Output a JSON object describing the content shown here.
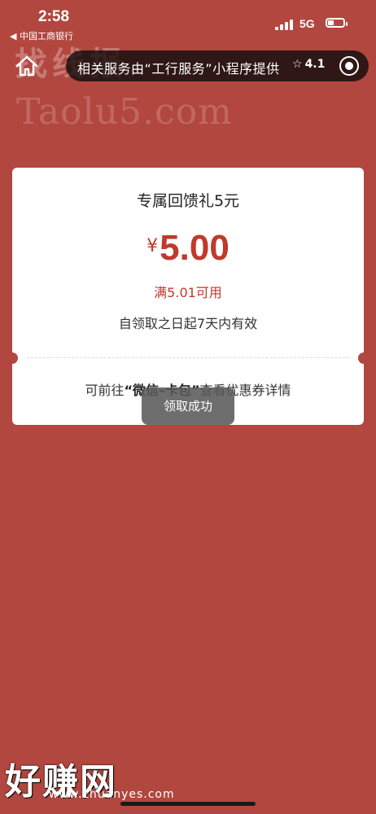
{
  "status": {
    "time": "2:58",
    "back_app": "◀ 中国工商银行",
    "network": "5G"
  },
  "header": {
    "notice": "相关服务由“工行服务”小程序提供",
    "rating": "4.1"
  },
  "watermark": {
    "top_text": "找线报",
    "site": "Taolu5.com",
    "bottom_text": "好赚网",
    "bottom_site": "www.zhuanyes.com"
  },
  "coupon": {
    "title": "专属回馈礼5元",
    "currency": "¥",
    "amount": "5.00",
    "condition": "满5.01可用",
    "validity": "自领取之日起7天内有效",
    "detail_prefix": "可前往",
    "detail_bold": "“微信–卡包”",
    "detail_suffix": "查看优惠券详情"
  },
  "toast": "领取成功",
  "colors": {
    "background": "#b2473f",
    "accent": "#c0392b",
    "card": "#ffffff"
  }
}
